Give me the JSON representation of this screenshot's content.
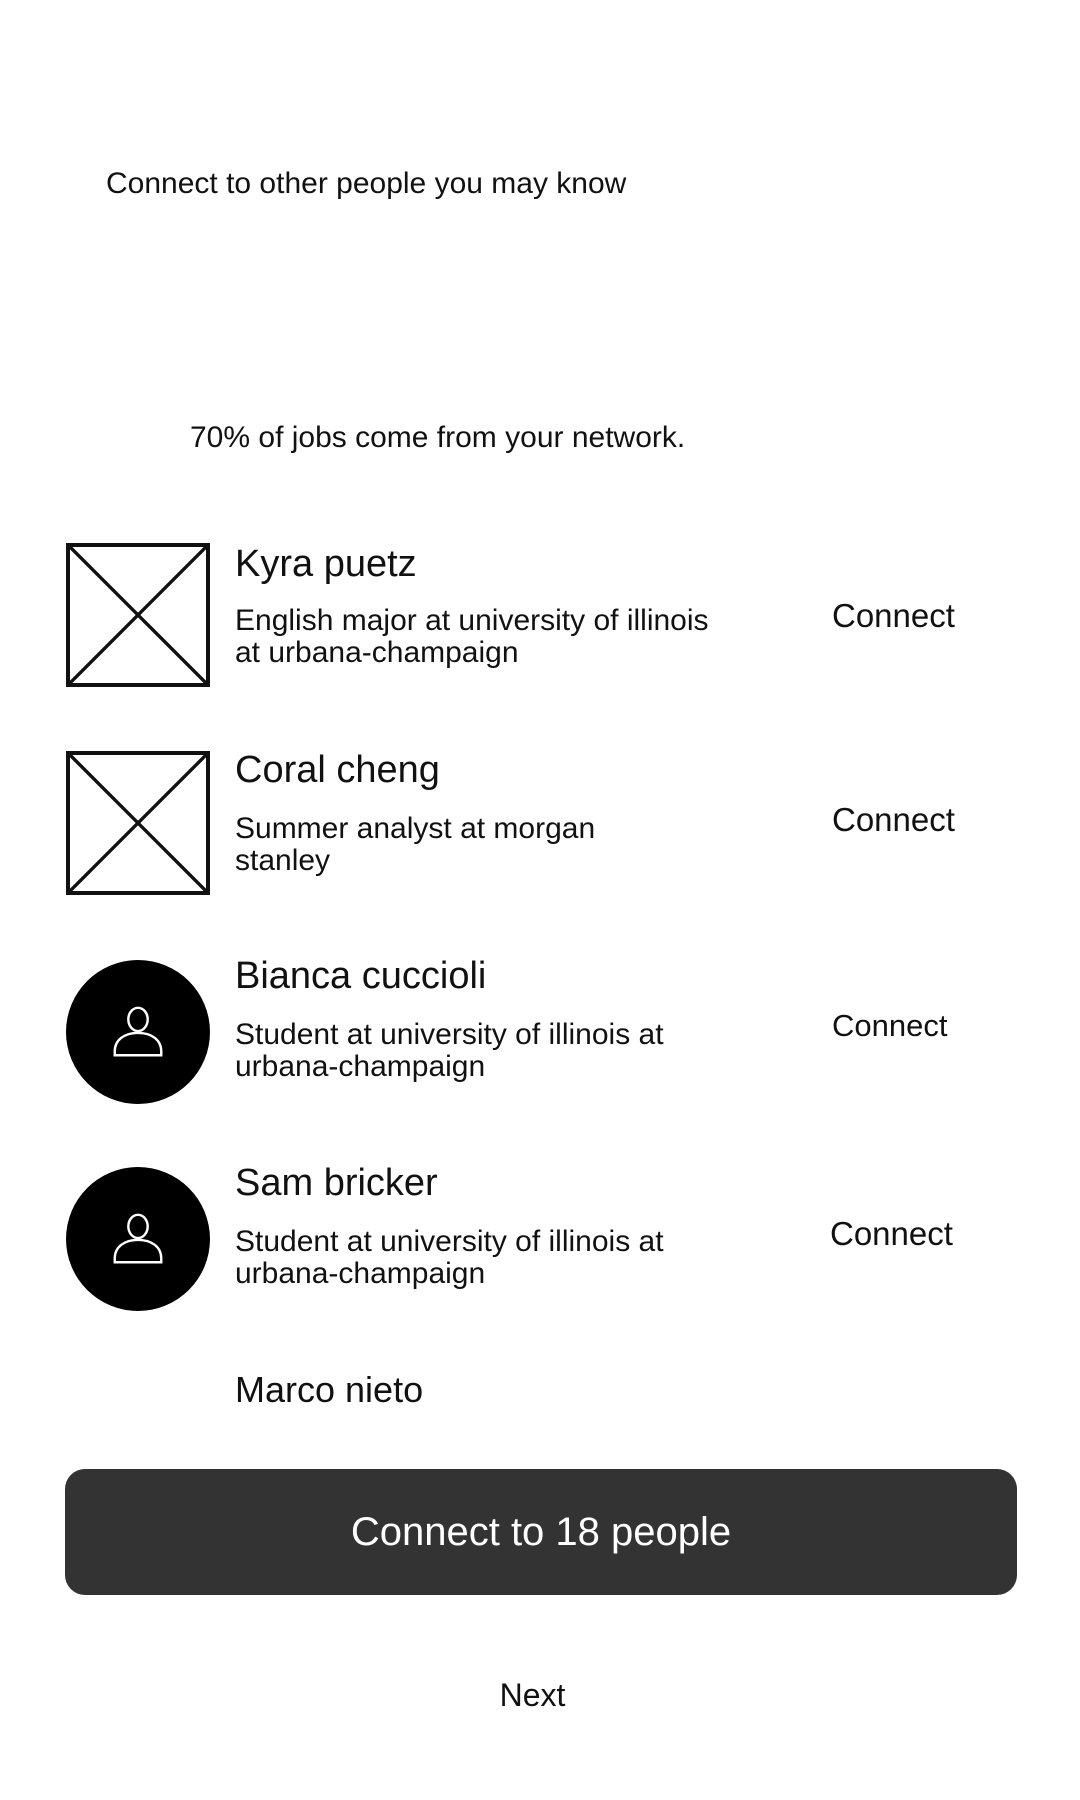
{
  "header": {
    "title": "Connect to other people you may know",
    "subtitle": "70% of jobs come from your network."
  },
  "people": [
    {
      "name": "Kyra puetz",
      "description": "English major at university of illinois at urbana-champaign",
      "avatar": "image-placeholder-icon",
      "action": "Connect"
    },
    {
      "name": "Coral cheng",
      "description": "Summer analyst at morgan stanley",
      "avatar": "image-placeholder-icon",
      "action": "Connect"
    },
    {
      "name": "Bianca cuccioli",
      "description": "Student at university of illinois at urbana-champaign",
      "avatar": "user-avatar-icon",
      "action": "Connect"
    },
    {
      "name": "Sam bricker",
      "description": "Student at university of illinois at urbana-champaign",
      "avatar": "user-avatar-icon",
      "action": "Connect"
    },
    {
      "name": "Marco nieto"
    }
  ],
  "actions": {
    "connect_all_label": "Connect to 18 people",
    "next_label": "Next"
  },
  "colors": {
    "primary_button": "#333333",
    "avatar_background": "#000000",
    "text": "#111111"
  }
}
